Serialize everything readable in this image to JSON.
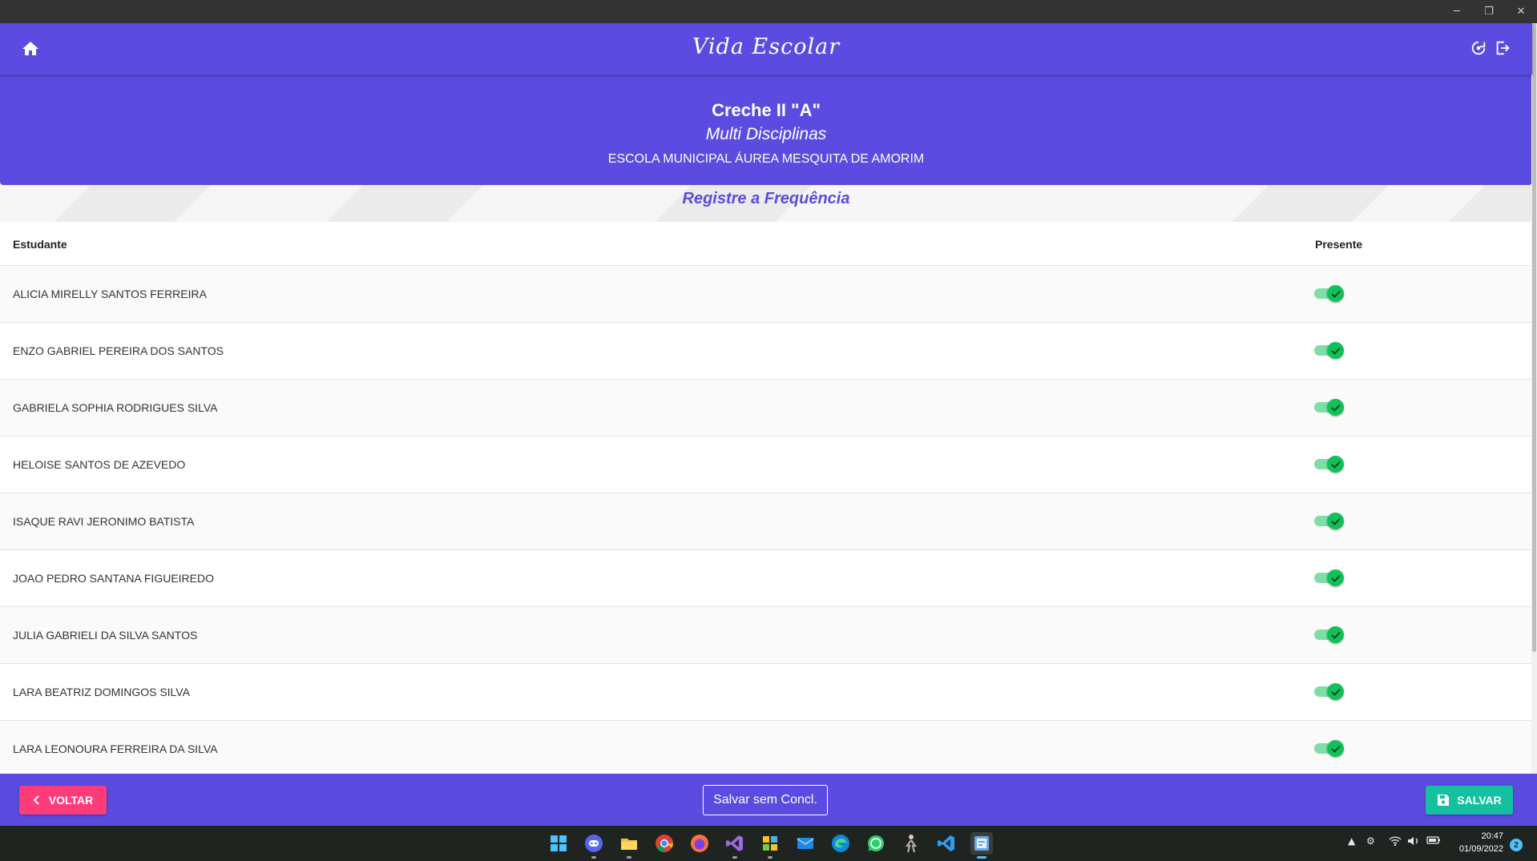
{
  "window": {
    "controls": {
      "minimize": "─",
      "restore": "❐",
      "close": "✕"
    }
  },
  "header": {
    "title": "Vida Escolar",
    "home_icon": "home-icon",
    "sync_icon": "sync-icon",
    "logout_icon": "logout-icon"
  },
  "class_info": {
    "name": "Creche II \"A\"",
    "subject": "Multi Disciplinas",
    "school": "ESCOLA MUNICIPAL ÁUREA MESQUITA DE AMORIM"
  },
  "attendance": {
    "title": "Registre a Frequência",
    "columns": {
      "student": "Estudante",
      "present": "Presente"
    },
    "students": [
      {
        "name": "ALICIA MIRELLY SANTOS FERREIRA",
        "present": true
      },
      {
        "name": "ENZO GABRIEL PEREIRA DOS SANTOS",
        "present": true
      },
      {
        "name": "GABRIELA SOPHIA RODRIGUES SILVA",
        "present": true
      },
      {
        "name": "HELOISE SANTOS DE AZEVEDO",
        "present": true
      },
      {
        "name": "ISAQUE RAVI JERONIMO BATISTA",
        "present": true
      },
      {
        "name": "JOAO PEDRO SANTANA FIGUEIREDO",
        "present": true
      },
      {
        "name": "JULIA GABRIELI DA SILVA SANTOS",
        "present": true
      },
      {
        "name": "LARA BEATRIZ DOMINGOS SILVA",
        "present": true
      },
      {
        "name": "LARA LEONOURA FERREIRA DA SILVA",
        "present": true
      }
    ]
  },
  "footer": {
    "back_label": "VOLTAR",
    "save_without_conclusion_label": "Salvar sem Concl.",
    "save_label": "SALVAR"
  },
  "taskbar": {
    "clock_time": "20:47",
    "clock_date": "01/09/2022",
    "notification_count": "2"
  },
  "colors": {
    "primary": "#5b4be1",
    "back_button": "#ff3c7a",
    "save_button": "#14c0a0",
    "toggle_on": "#10c058"
  }
}
